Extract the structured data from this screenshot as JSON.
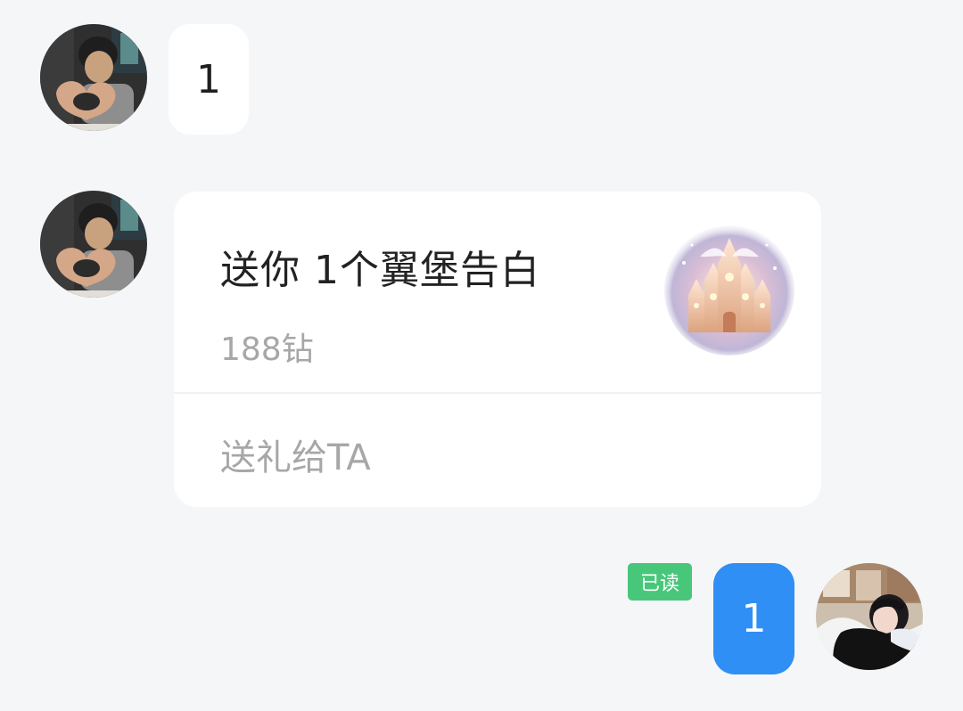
{
  "messages": [
    {
      "direction": "incoming",
      "avatar_icon": "avatar-man-heart-hands",
      "text": "1"
    },
    {
      "direction": "incoming",
      "type": "gift",
      "avatar_icon": "avatar-man-heart-hands",
      "gift": {
        "title": "送你 1个翼堡告白",
        "price": "188钻",
        "action_label": "送礼给TA",
        "image_icon": "castle-gift-icon"
      }
    },
    {
      "direction": "outgoing",
      "avatar_icon": "avatar-woman-lying",
      "read_status": "已读",
      "text": "1"
    }
  ],
  "colors": {
    "background": "#f5f6f8",
    "incoming_bubble": "#ffffff",
    "outgoing_bubble": "#2f8ff5",
    "read_badge": "#48c77b",
    "muted_text": "#a7a7a7"
  }
}
